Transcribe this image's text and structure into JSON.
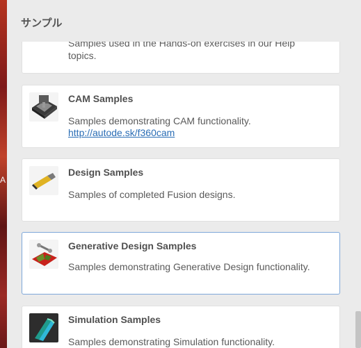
{
  "panel": {
    "title": "サンプル"
  },
  "desktop": {
    "edge_letter": "A"
  },
  "cards": [
    {
      "title": "",
      "description": "Samples used in the Hands-on exercises in our Help topics."
    },
    {
      "title": "CAM Samples",
      "description": "Samples demonstrating CAM functionality.",
      "link": "http://autode.sk/f360cam"
    },
    {
      "title": "Design Samples",
      "description": "Samples of completed Fusion designs."
    },
    {
      "title": "Generative Design Samples",
      "description": "Samples demonstrating Generative Design functionality."
    },
    {
      "title": "Simulation Samples",
      "description": "Samples demonstrating Simulation functionality."
    }
  ],
  "colors": {
    "panel_bg": "#ebebeb",
    "card_bg": "#ffffff",
    "selected_border": "#7da7d9",
    "link": "#2a6db5"
  }
}
